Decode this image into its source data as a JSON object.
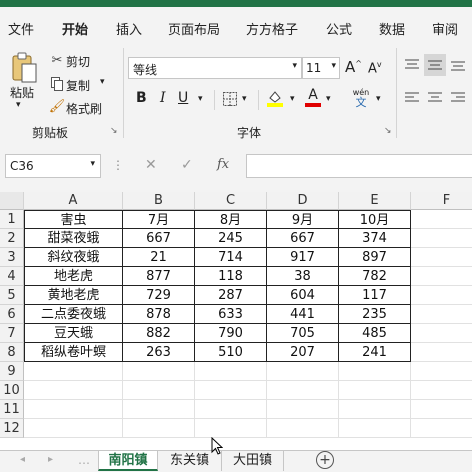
{
  "menu": {
    "tabs": [
      "文件",
      "开始",
      "插入",
      "页面布局",
      "方方格子",
      "公式",
      "数据",
      "审阅"
    ],
    "active": "开始"
  },
  "ribbon": {
    "paste_label": "粘贴",
    "cut_label": "剪切",
    "copy_label": "复制",
    "format_painter_label": "格式刷",
    "clipboard_group": "剪贴板",
    "font_name": "等线",
    "font_size": "11",
    "bold": "B",
    "italic": "I",
    "underline": "U",
    "font_color_glyph": "A",
    "phonetic_top": "wén",
    "phonetic_bottom": "文",
    "grow_font": "A",
    "shrink_font": "A",
    "font_group": "字体"
  },
  "formula_bar": {
    "name_box": "C36",
    "fx": "fx",
    "cancel": "✕",
    "enter": "✓",
    "formula": ""
  },
  "grid": {
    "columns": [
      "A",
      "B",
      "C",
      "D",
      "E",
      "F"
    ],
    "rows": [
      "1",
      "2",
      "3",
      "4",
      "5",
      "6",
      "7",
      "8",
      "9",
      "10",
      "11",
      "12"
    ],
    "cells": [
      [
        "害虫",
        "7月",
        "8月",
        "9月",
        "10月"
      ],
      [
        "甜菜夜蛾",
        "667",
        "245",
        "667",
        "374"
      ],
      [
        "斜纹夜蛾",
        "21",
        "714",
        "917",
        "897"
      ],
      [
        "地老虎",
        "877",
        "118",
        "38",
        "782"
      ],
      [
        "黄地老虎",
        "729",
        "287",
        "604",
        "117"
      ],
      [
        "二点委夜蛾",
        "878",
        "633",
        "441",
        "235"
      ],
      [
        "豆天蛾",
        "882",
        "790",
        "705",
        "485"
      ],
      [
        "稻纵卷叶螟",
        "263",
        "510",
        "207",
        "241"
      ]
    ]
  },
  "sheets": {
    "tabs": [
      "南阳镇",
      "东关镇",
      "大田镇"
    ],
    "active": "南阳镇",
    "add": "+"
  },
  "colors": {
    "accent": "#217346",
    "font_color_bar": "#e00000",
    "highlight_bar": "#ffff00"
  }
}
